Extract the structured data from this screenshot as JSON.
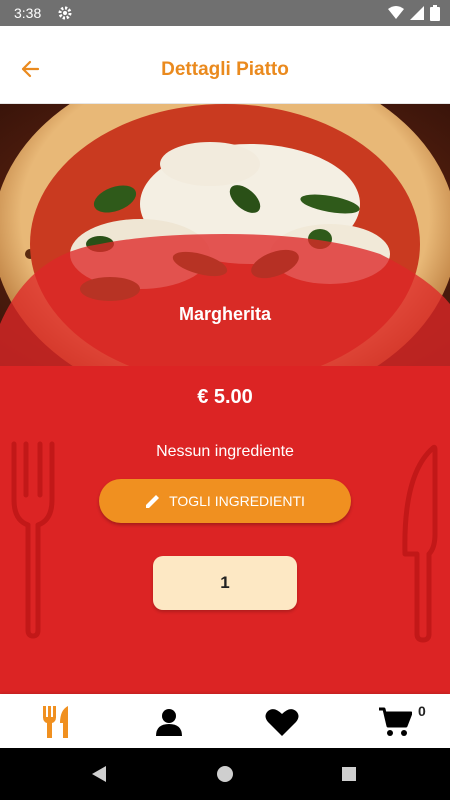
{
  "status_bar": {
    "time": "3:38"
  },
  "app_bar": {
    "title": "Dettagli Piatto"
  },
  "dish": {
    "name": "Margherita",
    "price": "€ 5.00",
    "ingredients_text": "Nessun ingrediente",
    "remove_ingredients_label": "TOGLI INGREDIENTI",
    "quantity": "1"
  },
  "bottom_nav": {
    "items": [
      {
        "icon": "fork-knife-icon"
      },
      {
        "icon": "user-icon"
      },
      {
        "icon": "heart-icon"
      },
      {
        "icon": "cart-icon"
      }
    ],
    "cart_count": "0"
  },
  "colors": {
    "accent_orange": "#ea8a1e",
    "detail_red": "#dc2424",
    "quantity_bg": "#fde8c4"
  }
}
